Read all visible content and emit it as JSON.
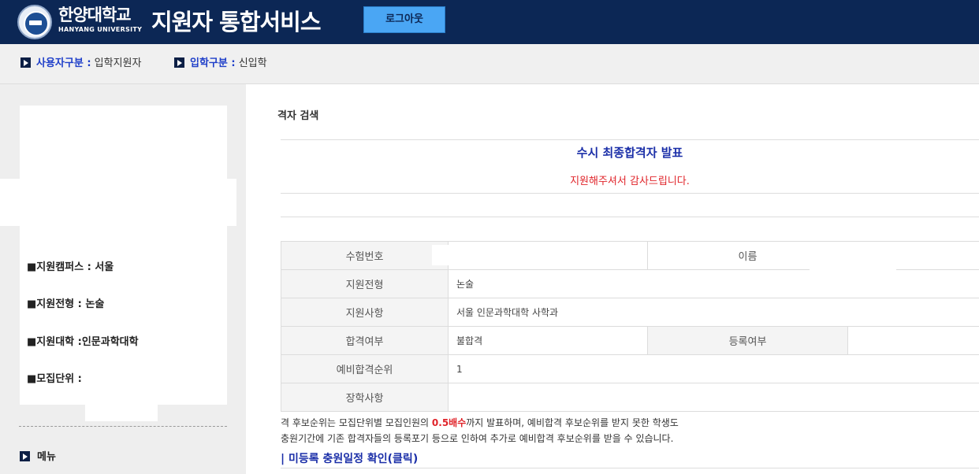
{
  "header": {
    "univ_ko": "한양대학교",
    "univ_en": "HANYANG UNIVERSITY",
    "service_title": "지원자 통합서비스",
    "logout_label": "로그아웃"
  },
  "infobar": {
    "user_type_label": "사용자구분 :",
    "user_type_value": "입학지원자",
    "admission_type_label": "입학구분 :",
    "admission_type_value": "신입학"
  },
  "sidebar": {
    "campus": "■지원캠퍼스 : 서울",
    "track": "■지원전형 : 논술",
    "college": "■지원대학 :인문과학대학",
    "unit": "■모집단위 :",
    "menu_label": "메뉴"
  },
  "main": {
    "breadcrumb": "격자 검색",
    "notice_title": "수시 최종합격자 발표",
    "notice_sub": "지원해주셔서 감사드립니다.",
    "table": {
      "exam_no_label": "수험번호",
      "exam_no_value": "",
      "name_label": "이름",
      "name_value": "",
      "track_label": "지원전형",
      "track_value": "논술",
      "dept_label": "지원사항",
      "dept_value": "서울 인문과학대학 사학과",
      "pass_label": "합격여부",
      "pass_value": "불합격",
      "register_label": "등록여부",
      "register_value": "",
      "waitlist_label": "예비합격순위",
      "waitlist_value": "1",
      "scholarship_label": "장학사항",
      "scholarship_value": ""
    },
    "footnote1_a": "격 후보순위는 모집단위별 모집인원의 ",
    "footnote1_em": "0.5배수",
    "footnote1_b": "까지 발표하며, 예비합격 후보순위를 받지 못한 학생도",
    "footnote2": " 충원기간에 기존 합격자들의 등록포기 등으로 인하여 추가로 예비합격 후보순위를 받을 수 있습니다.",
    "schedule_link": "| 미등록 충원일정 확인(클릭)"
  },
  "colors": {
    "header_bg": "#0c2755",
    "logout_bg": "#4aa6f4",
    "accent_blue": "#1b2fa8",
    "accent_red": "#e0242a"
  }
}
